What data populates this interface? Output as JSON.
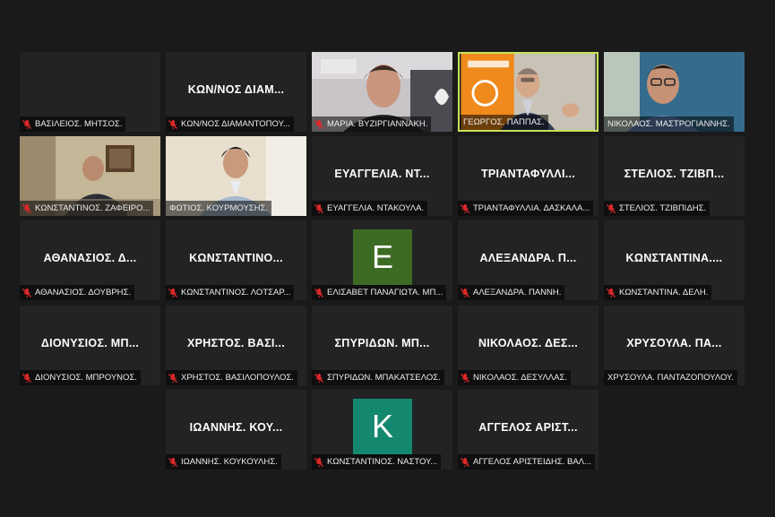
{
  "participants": [
    {
      "tile_name": "",
      "label": "ΒΑΣΙΛΕΙΟΣ. ΜΗΤΣΟΣ.",
      "muted": true,
      "video": false
    },
    {
      "tile_name": "ΚΩΝ/ΝΟΣ ΔΙΑΜ...",
      "label": "ΚΩΝ/ΝΟΣ ΔΙΑΜΑΝΤΟΠΟΥ...",
      "muted": true,
      "video": false
    },
    {
      "tile_name": "",
      "label": "ΜΑΡΙΑ. ΒΥΖΙΡΓΙΑΝΝΑΚΗ.",
      "muted": true,
      "video": true,
      "scene": "woman"
    },
    {
      "tile_name": "",
      "label": "ΓΕΩΡΓΟΣ. ΠΑΠΠΑΣ.",
      "muted": false,
      "video": true,
      "scene": "speaker",
      "active": true
    },
    {
      "tile_name": "",
      "label": "ΝΙΚΟΛΑΟΣ. ΜΑΣΤΡΟΓΙΑΝΝΗΣ.",
      "muted": false,
      "video": true,
      "scene": "glasses-man"
    },
    {
      "tile_name": "",
      "label": "ΚΩΝΣΤΑΝΤΙΝΟΣ. ΖΑΦΕΙΡΟ...",
      "muted": true,
      "video": true,
      "scene": "room-man"
    },
    {
      "tile_name": "",
      "label": "ΦΩΤΙΟΣ. ΚΟΥΡΜΟΥΣΗΣ.",
      "muted": false,
      "video": true,
      "scene": "young-man"
    },
    {
      "tile_name": "ΕΥΑΓΓΕΛΙΑ. ΝΤ...",
      "label": "ΕΥΑΓΓΕΛΙΑ. ΝΤΑΚΟΥΛΑ.",
      "muted": true,
      "video": false
    },
    {
      "tile_name": "ΤΡΙΑΝΤΑΦΥΛΛΙ...",
      "label": "ΤΡΙΑΝΤΑΦΥΛΛΙΑ. ΔΑΣΚΑΛΑ...",
      "muted": true,
      "video": false
    },
    {
      "tile_name": "ΣΤΕΛΙΟΣ. ΤΖΙΒΠ...",
      "label": "ΣΤΕΛΙΟΣ. ΤΖΙΒΠΙΔΗΣ.",
      "muted": true,
      "video": false
    },
    {
      "tile_name": "ΑΘΑΝΑΣΙΟΣ. Δ...",
      "label": "ΑΘΑΝΑΣΙΟΣ. ΔΟΥΒΡΗΣ.",
      "muted": true,
      "video": false
    },
    {
      "tile_name": "ΚΩΝΣΤΑΝΤΙΝΟ...",
      "label": "ΚΩΝΣΤΑΝΤΙΝΟΣ. ΛΟΤΣΑΡ...",
      "muted": true,
      "video": false
    },
    {
      "tile_name": "",
      "label": "ΕΛΙΣΑΒΕΤ ΠΑΝΑΓΙΩΤΑ. ΜΠ...",
      "muted": true,
      "video": false,
      "avatar_letter": "E",
      "avatar_color": "#3d6b23"
    },
    {
      "tile_name": "ΑΛΕΞΑΝΔΡΑ. Π...",
      "label": "ΑΛΕΞΑΝΔΡΑ. ΠΑΝΝΗ.",
      "muted": true,
      "video": false
    },
    {
      "tile_name": "ΚΩΝΣΤΑΝΤΙΝΑ....",
      "label": "ΚΩΝΣΤΑΝΤΙΝΑ. ΔΕΛΗ.",
      "muted": true,
      "video": false
    },
    {
      "tile_name": "ΔΙΟΝΥΣΙΟΣ. ΜΠ...",
      "label": "ΔΙΟΝΥΣΙΟΣ. ΜΠΡΟΥΝΟΣ.",
      "muted": true,
      "video": false
    },
    {
      "tile_name": "ΧΡΗΣΤΟΣ. ΒΑΣΙ...",
      "label": "ΧΡΗΣΤΟΣ. ΒΑΣΙΛΟΠΟΥΛΟΣ.",
      "muted": true,
      "video": false
    },
    {
      "tile_name": "ΣΠΥΡΙΔΩΝ. ΜΠ...",
      "label": "ΣΠΥΡΙΔΩΝ. ΜΠΑΚΑΤΣΕΛΟΣ.",
      "muted": true,
      "video": false
    },
    {
      "tile_name": "ΝΙΚΟΛΑΟΣ. ΔΕΣ...",
      "label": "ΝΙΚΟΛΑΟΣ. ΔΕΣΥΛΛΑΣ.",
      "muted": true,
      "video": false
    },
    {
      "tile_name": "ΧΡΥΣΟΥΛΑ. ΠΑ...",
      "label": "ΧΡΥΣΟΥΛΑ. ΠΑΝΤΑΖΟΠΟΥΛΟΥ.",
      "muted": false,
      "video": false
    },
    {
      "tile_name": "ΙΩΑΝΝΗΣ. ΚΟΥ...",
      "label": "ΙΩΑΝΝΗΣ. ΚΟΥΚΟΥΛΗΣ.",
      "muted": true,
      "video": false
    },
    {
      "tile_name": "",
      "label": "ΚΩΝΣΤΑΝΤΙΝΟΣ. ΝΑΣΤΟΥ...",
      "muted": true,
      "video": false,
      "avatar_letter": "K",
      "avatar_color": "#14876f"
    },
    {
      "tile_name": "ΑΓΓΕΛΟΣ ΑΡΙΣΤ...",
      "label": "ΑΓΓΕΛΟΣ ΑΡΙΣΤΕΙΔΗΣ. ΒΑΛ...",
      "muted": true,
      "video": false
    }
  ],
  "colors": {
    "background": "#1a1a1a",
    "tile": "#232323",
    "active_border": "#c8e35a",
    "muted_icon": "#e02828"
  }
}
